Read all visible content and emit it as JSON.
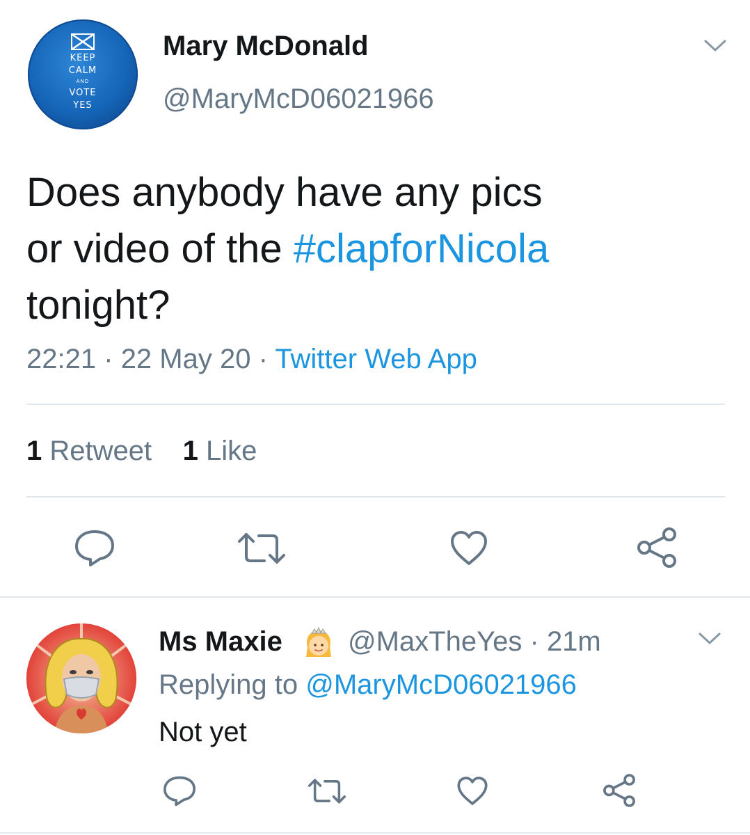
{
  "tweet": {
    "author_name": "Mary McDonald",
    "author_handle": "@MaryMcD06021966",
    "avatar_lines": [
      "KEEP",
      "CALM",
      "AND",
      "VOTE",
      "YES"
    ],
    "text_line1": "Does anybody have any pics",
    "text_line2_prefix": "or video of the ",
    "hashtag": "#clapforNicola",
    "text_line3": "tonight?",
    "time": "22:21",
    "separator": "·",
    "date": "22 May 20",
    "source": "Twitter Web App",
    "retweet_count": "1",
    "retweet_label": "Retweet",
    "like_count": "1",
    "like_label": "Like",
    "icons": [
      "reply-icon",
      "retweet-icon",
      "like-icon",
      "share-icon",
      "chevron-down-icon"
    ]
  },
  "reply": {
    "author_name": "Ms Maxie",
    "author_emoji": "princess-emoji",
    "author_handle": "@MaxTheYes",
    "time_ago": "21m",
    "replying_to_label": "Replying to",
    "replying_to_handle": "@MaryMcD06021966",
    "text": "Not yet"
  },
  "colors": {
    "link": "#1b95e0",
    "secondary_text": "#657786",
    "primary_text": "#14171a",
    "divider": "#e1e8ed",
    "icon": "#657786"
  }
}
